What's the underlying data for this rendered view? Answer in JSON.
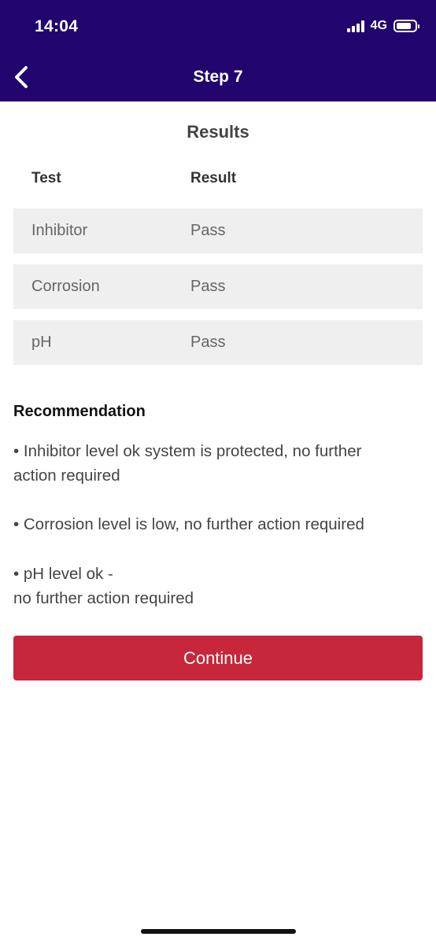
{
  "status_bar": {
    "time": "14:04",
    "network": "4G",
    "signal_bars": 4,
    "battery_level": 0.8,
    "background_color": "#22046f"
  },
  "nav": {
    "back_icon": "chevron-left-icon",
    "title": "Step 7"
  },
  "results": {
    "title": "Results",
    "headers": {
      "test": "Test",
      "result": "Result"
    },
    "rows": [
      {
        "test": "Inhibitor",
        "result": "Pass"
      },
      {
        "test": "Corrosion",
        "result": "Pass"
      },
      {
        "test": "pH",
        "result": "Pass"
      }
    ]
  },
  "recommendation": {
    "title": "Recommendation",
    "items": [
      {
        "line1": "• Inhibitor level ok system is protected, no further",
        "line2": "action required"
      },
      {
        "line1": "• Corrosion level is low, no further action required",
        "line2": ""
      },
      {
        "line1": "• pH level ok -",
        "line2": "no further action required"
      }
    ]
  },
  "actions": {
    "continue_label": "Continue",
    "continue_color": "#c8263a"
  }
}
